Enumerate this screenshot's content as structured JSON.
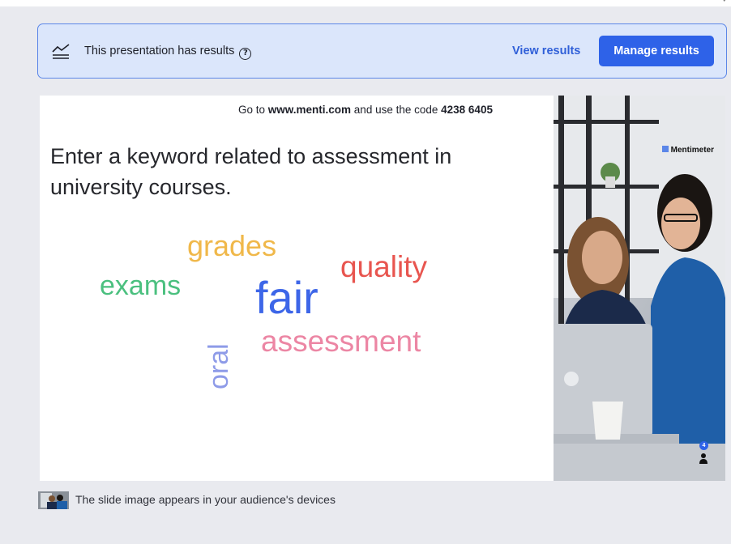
{
  "banner": {
    "text": "This presentation has results",
    "help_glyph": "?",
    "view_label": "View results",
    "manage_label": "Manage results",
    "icon": "chart-lines-icon"
  },
  "slide": {
    "join_prefix": "Go to ",
    "join_url": "www.menti.com",
    "join_middle": " and use the code ",
    "join_code": "4238 6405",
    "question": "Enter a keyword related to assessment in university courses.",
    "words": [
      {
        "text": "grades",
        "color": "#f0b84a"
      },
      {
        "text": "quality",
        "color": "#e8554f"
      },
      {
        "text": "exams",
        "color": "#4bc07f"
      },
      {
        "text": "fair",
        "color": "#3d66e8"
      },
      {
        "text": "assessment",
        "color": "#ec86a4"
      },
      {
        "text": "oral",
        "color": "#8e9be8"
      }
    ],
    "brand": "Mentimeter",
    "participant_count": "4"
  },
  "footer": {
    "text": "The slide image appears in your audience's devices"
  },
  "colors": {
    "accent": "#2e62e8",
    "banner_bg": "#dbe6fb",
    "banner_border": "#5b86e8",
    "page_bg": "#e9eaef"
  }
}
